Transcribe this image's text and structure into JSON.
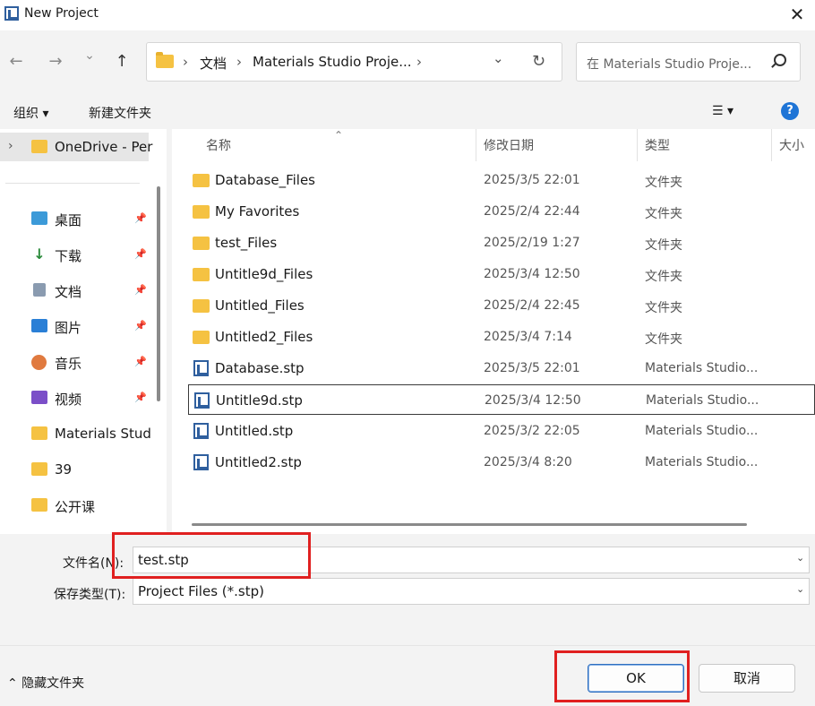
{
  "window": {
    "title": "New Project",
    "close": "✕"
  },
  "nav": {
    "back": "←",
    "forward": "→",
    "recent": "⌄",
    "up": "↑",
    "breadcrumb": [
      "文档",
      "Materials Studio Proje..."
    ],
    "sep": "›",
    "dropdown": "⌄",
    "refresh": "↻",
    "search_placeholder": "在 Materials Studio Proje..."
  },
  "toolbar": {
    "organize": "组织 ▾",
    "new_folder": "新建文件夹",
    "view": "☰ ▾",
    "help": "?"
  },
  "sidebar": {
    "onedrive": "OneDrive - Per",
    "expand": "›",
    "items": [
      {
        "label": "桌面",
        "icon": "desktop-icon",
        "pinned": true
      },
      {
        "label": "下载",
        "icon": "download-icon",
        "pinned": true
      },
      {
        "label": "文档",
        "icon": "document-icon",
        "pinned": true
      },
      {
        "label": "图片",
        "icon": "pictures-icon",
        "pinned": true
      },
      {
        "label": "音乐",
        "icon": "music-icon",
        "pinned": true
      },
      {
        "label": "视频",
        "icon": "video-icon",
        "pinned": true
      },
      {
        "label": "Materials Stud",
        "icon": "folder-icon",
        "pinned": false
      },
      {
        "label": "39",
        "icon": "folder-icon",
        "pinned": false
      },
      {
        "label": "公开课",
        "icon": "folder-icon",
        "pinned": false
      }
    ]
  },
  "columns": {
    "name": "名称",
    "modified": "修改日期",
    "type": "类型",
    "size": "大小"
  },
  "files": [
    {
      "name": "Database_Files",
      "date": "2025/3/5 22:01",
      "type": "文件夹",
      "kind": "folder"
    },
    {
      "name": "My Favorites",
      "date": "2025/2/4 22:44",
      "type": "文件夹",
      "kind": "folder"
    },
    {
      "name": "test_Files",
      "date": "2025/2/19 1:27",
      "type": "文件夹",
      "kind": "folder"
    },
    {
      "name": "Untitle9d_Files",
      "date": "2025/3/4 12:50",
      "type": "文件夹",
      "kind": "folder"
    },
    {
      "name": "Untitled_Files",
      "date": "2025/2/4 22:45",
      "type": "文件夹",
      "kind": "folder"
    },
    {
      "name": "Untitled2_Files",
      "date": "2025/3/4 7:14",
      "type": "文件夹",
      "kind": "folder"
    },
    {
      "name": "Database.stp",
      "date": "2025/3/5 22:01",
      "type": "Materials Studio...",
      "kind": "stp"
    },
    {
      "name": "Untitle9d.stp",
      "date": "2025/3/4 12:50",
      "type": "Materials Studio...",
      "kind": "stp",
      "selected": true
    },
    {
      "name": "Untitled.stp",
      "date": "2025/3/2 22:05",
      "type": "Materials Studio...",
      "kind": "stp"
    },
    {
      "name": "Untitled2.stp",
      "date": "2025/3/4 8:20",
      "type": "Materials Studio...",
      "kind": "stp"
    }
  ],
  "bottom": {
    "filename_label": "文件名(N):",
    "filename_value": "test.stp",
    "filetype_label": "保存类型(T):",
    "filetype_value": "Project Files (*.stp)",
    "hide_folders": "⌃  隐藏文件夹",
    "ok": "OK",
    "cancel": "取消"
  },
  "colors": {
    "highlight": "#e02020",
    "folder": "#f5c242",
    "accent": "#2f6fc0"
  }
}
